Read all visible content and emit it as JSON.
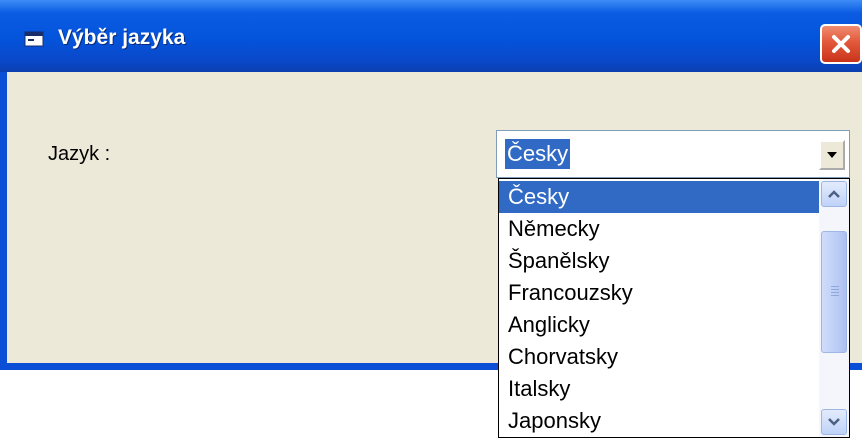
{
  "window": {
    "title": "Výběr jazyka",
    "close_icon": "close-x-icon",
    "app_icon": "window-app-icon"
  },
  "form": {
    "label": "Jazyk :",
    "combo_value": "Česky",
    "combo_icon": "dropdown-arrow-icon"
  },
  "dropdown": {
    "items": [
      "Česky",
      "Německy",
      "Španělsky",
      "Francouzsky",
      "Anglicky",
      "Chorvatsky",
      "Italsky",
      "Japonsky"
    ],
    "selected_index": 0
  },
  "colors": {
    "titlebar": "#0453db",
    "selection": "#316ac5",
    "client": "#ece9d8",
    "close_button": "#e2583b"
  }
}
